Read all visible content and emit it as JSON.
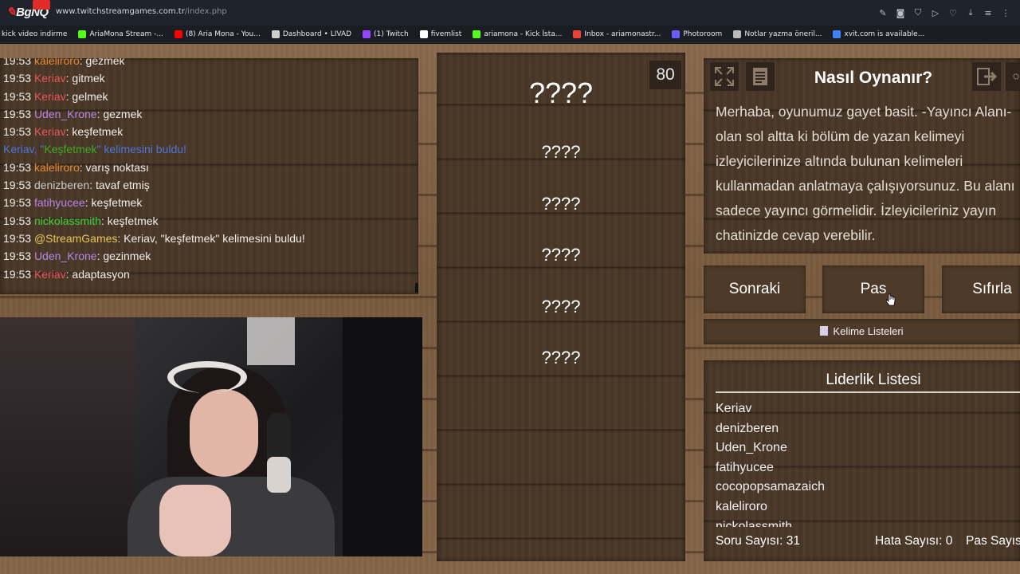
{
  "browser": {
    "logo_text": "BgNQ",
    "url_host": "www.twitchstreamgames.com.tr",
    "url_path": "/index.php",
    "toolbar_icons": [
      "edit-icon",
      "camera-icon",
      "shield-icon",
      "play-icon",
      "heart-icon",
      "download-icon",
      "menu-icon",
      "more-icon"
    ]
  },
  "bookmarks": [
    {
      "label": "kick video indirme",
      "color": ""
    },
    {
      "label": "AriaMona Stream -...",
      "color": "#53fc18"
    },
    {
      "label": "(8) Aria Mona - You...",
      "color": "#ff0000"
    },
    {
      "label": "Dashboard • LIVAD",
      "color": "#cccccc"
    },
    {
      "label": "(1) Twitch",
      "color": "#9146ff"
    },
    {
      "label": "fivemlist",
      "color": "#ffffff"
    },
    {
      "label": "ariamona - Kick İsta...",
      "color": "#53fc18"
    },
    {
      "label": "Inbox - ariamonastr...",
      "color": "#ea4335"
    },
    {
      "label": "Photoroom",
      "color": "#6a5cff"
    },
    {
      "label": "Notlar yazma öneril...",
      "color": "#bbbbbb"
    },
    {
      "label": "xvit.com is available...",
      "color": "#3b82f6"
    }
  ],
  "chat": {
    "lines": [
      {
        "time": "19:53",
        "user": "kaleliroro",
        "user_color": "#e8892f",
        "text": ": gezmek"
      },
      {
        "time": "19:53",
        "user": "Keriav",
        "user_color": "#e8545e",
        "text": ": gitmek"
      },
      {
        "time": "19:53",
        "user": "Keriav",
        "user_color": "#e8545e",
        "text": ": gelmek"
      },
      {
        "time": "19:53",
        "user": "Uden_Krone",
        "user_color": "#b685e8",
        "text": ": gezmek"
      },
      {
        "time": "19:53",
        "user": "Keriav",
        "user_color": "#e8545e",
        "text": ": keşfetmek"
      },
      {
        "system": true,
        "pre": "Keriav, \"",
        "word": "Keşfetmek",
        "post": "\" kelimesini buldu!"
      },
      {
        "time": "19:53",
        "user": "kaleliroro",
        "user_color": "#e8892f",
        "text": ": varış noktası"
      },
      {
        "time": "19:53",
        "user": "denizberen",
        "user_color": "#c9c9c9",
        "text": ": tavaf etmiş"
      },
      {
        "time": "19:53",
        "user": "fatihyucee",
        "user_color": "#b685e8",
        "text": ": keşfetmek"
      },
      {
        "time": "19:53",
        "user": "nickolassmith",
        "user_color": "#3fd43f",
        "text": ": keşfetmek"
      },
      {
        "time": "19:53",
        "user": "@StreamGames",
        "user_color": "#e8c75a",
        "text": ": Keriav, \"keşfetmek\" kelimesini buldu!"
      },
      {
        "time": "19:53",
        "user": "Uden_Krone",
        "user_color": "#b685e8",
        "text": ": gezinmek"
      },
      {
        "time": "19:53",
        "user": "Keriav",
        "user_color": "#e8545e",
        "text": ": adaptasyon"
      }
    ]
  },
  "words": {
    "hidden": [
      "????",
      "????",
      "????",
      "????",
      "????",
      "????"
    ],
    "counter": "80"
  },
  "howto": {
    "title": "Nasıl Oynanır?",
    "lines": [
      "Merhaba, oyunumuz gayet basit. -Yayıncı Alanı-",
      "olan sol altta ki bölüm de yazan kelimeyi",
      "izleyicilerinize altında bulunan kelimeleri",
      "kullanmadan anlatmaya çalışıyorsunuz. Bu alanı",
      "sadece yayıncı görmelidir. İzleyicileriniz yayın",
      "chatinizde cevap verebilir."
    ]
  },
  "buttons": {
    "next": "Sonraki",
    "pass": "Pas",
    "reset": "Sıfırla",
    "word_lists": "Kelime Listeleri"
  },
  "leaderboard": {
    "title": "Liderlik Listesi",
    "entries": [
      "Keriav",
      "denizberen",
      "Uden_Krone",
      "fatihyucee",
      "cocopopsamazaich",
      "kaleliroro",
      "nickolassmith"
    ]
  },
  "stats": {
    "questions": "Soru Sayısı: 31",
    "errors": "Hata Sayısı: 0",
    "passes": "Pas Sayısı"
  }
}
